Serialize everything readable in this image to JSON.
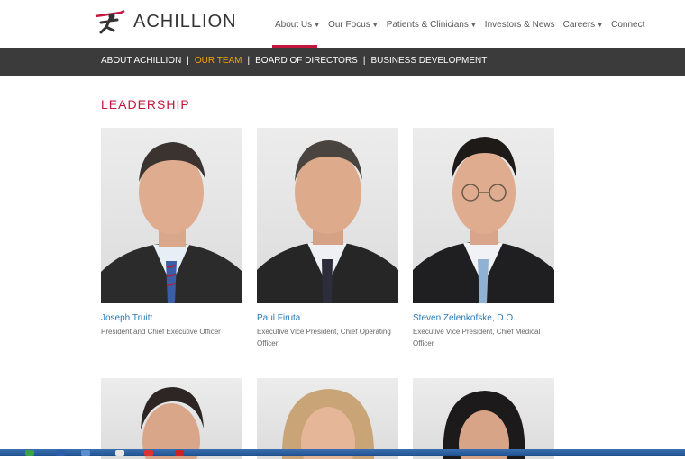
{
  "header": {
    "logo_text": "ACHILLION",
    "nav": [
      {
        "label": "About Us",
        "dropdown": true
      },
      {
        "label": "Our Focus",
        "dropdown": true
      },
      {
        "label": "Patients & Clinicians",
        "dropdown": true
      },
      {
        "label": "Investors & News",
        "dropdown": false
      },
      {
        "label": "Careers",
        "dropdown": true
      },
      {
        "label": "Connect",
        "dropdown": false
      }
    ]
  },
  "subnav": {
    "items": [
      "ABOUT ACHILLION",
      "OUR TEAM",
      "BOARD OF DIRECTORS",
      "BUSINESS DEVELOPMENT"
    ],
    "active": "OUR TEAM",
    "separator": "|"
  },
  "section": {
    "title": "LEADERSHIP"
  },
  "people": [
    {
      "name": "Joseph Truitt",
      "title": "President and Chief Executive Officer",
      "tie": "blue-red-striped-tie"
    },
    {
      "name": "Paul Firuta",
      "title": "Executive Vice President, Chief Operating Officer",
      "tie": "dark-patterned-tie"
    },
    {
      "name": "Steven Zelenkofske, D.O.",
      "title": "Executive Vice President, Chief Medical Officer",
      "tie": "light-blue-tie"
    }
  ],
  "colors": {
    "accent": "#c2183e",
    "subnav_bg": "#3b3b3b",
    "active_subnav": "#f0a500",
    "link": "#2a7ab5"
  }
}
